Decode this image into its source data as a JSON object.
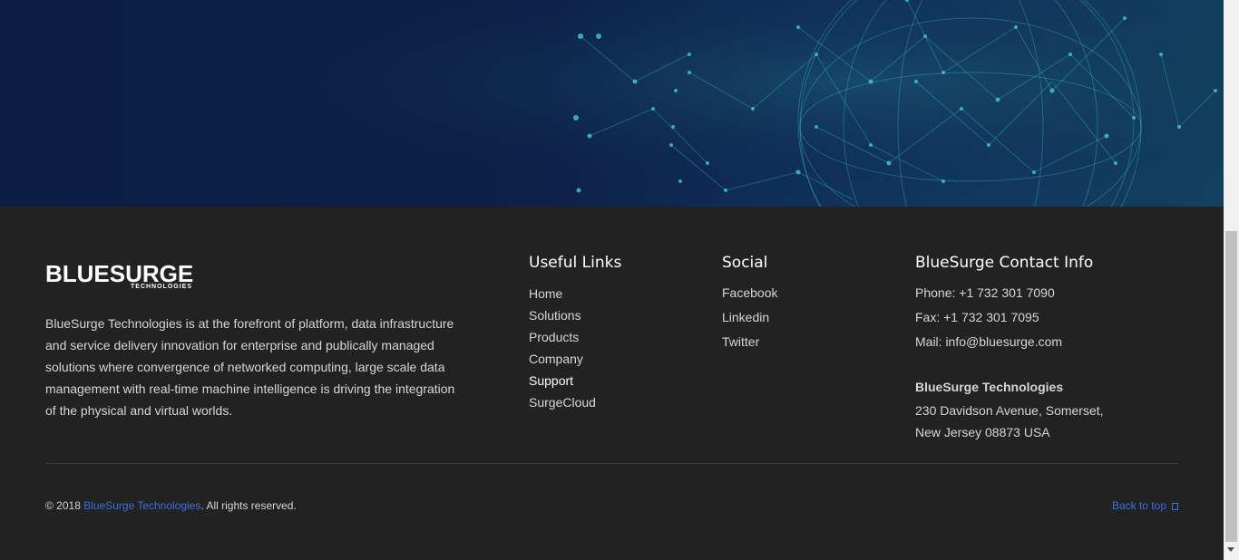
{
  "brand": {
    "logo_word": "BLUESURGE",
    "logo_sub": "TECHNOLOGIES",
    "description": "BlueSurge Technologies is at the forefront of platform, data infrastructure and service delivery innovation for enterprise and publically managed solutions where convergence of networked computing, large scale data management with real-time machine intelligence is driving the integration of the physical and virtual worlds."
  },
  "useful_links": {
    "title": "Useful Links",
    "items": [
      "Home",
      "Solutions",
      "Products",
      "Company",
      "Support",
      "SurgeCloud"
    ]
  },
  "social": {
    "title": "Social",
    "items": [
      "Facebook",
      "Linkedin",
      "Twitter"
    ]
  },
  "contact": {
    "title": "BlueSurge Contact Info",
    "phone": "Phone: +1 732 301 7090",
    "fax": "Fax: +1 732 301 7095",
    "mail": "Mail: info@bluesurge.com",
    "company": "BlueSurge Technologies",
    "address_line1": "230 Davidson Avenue, Somerset,",
    "address_line2": "New Jersey 08873 USA"
  },
  "bottom": {
    "copyright_prefix": "© 2018 ",
    "copyright_brand": "BlueSurge Technologies",
    "copyright_suffix": ". All rights reserved.",
    "back_to_top": "Back to top"
  },
  "colors": {
    "footer_bg": "#222222",
    "link_accent": "#3b6ee0",
    "hero_network": "#3fc1c9"
  },
  "icons": [
    "globe-network-graphic",
    "back-to-top-icon"
  ]
}
